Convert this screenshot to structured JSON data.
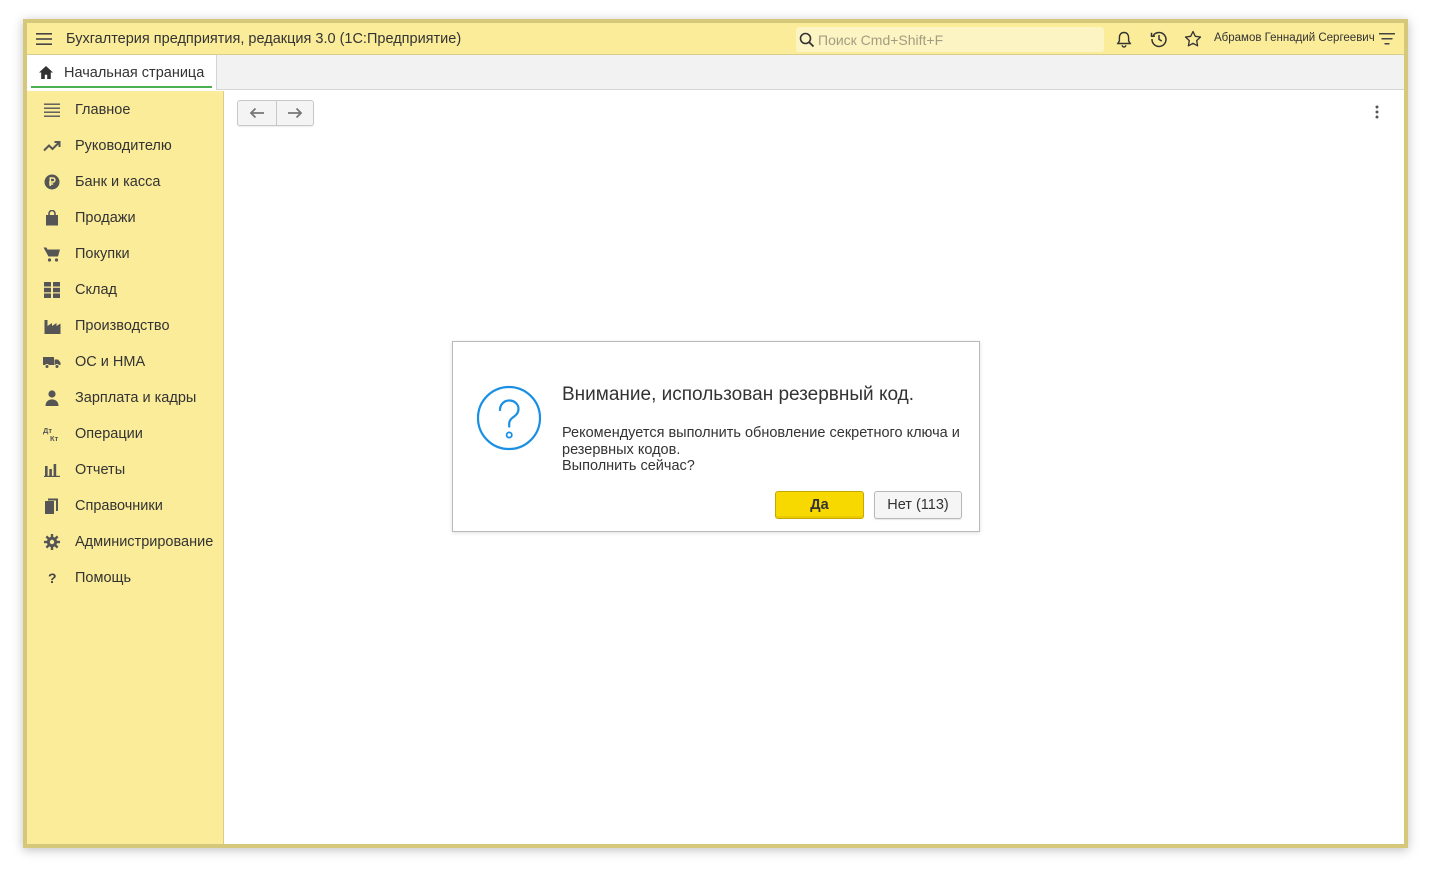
{
  "titlebar": {
    "app_title": "Бухгалтерия предприятия, редакция 3.0  (1С:Предприятие)",
    "search_placeholder": "Поиск Cmd+Shift+F",
    "user_name": "Абрамов Геннадий Сергеевич"
  },
  "tabs": [
    {
      "label": "Начальная страница",
      "icon": "home-icon"
    }
  ],
  "sidebar": {
    "items": [
      {
        "label": "Главное",
        "icon": "list-icon"
      },
      {
        "label": "Руководителю",
        "icon": "trend-up-icon"
      },
      {
        "label": "Банк и касса",
        "icon": "ruble-coin-icon"
      },
      {
        "label": "Продажи",
        "icon": "shopping-bag-icon"
      },
      {
        "label": "Покупки",
        "icon": "cart-icon"
      },
      {
        "label": "Склад",
        "icon": "warehouse-grid-icon"
      },
      {
        "label": "Производство",
        "icon": "factory-icon"
      },
      {
        "label": "ОС и НМА",
        "icon": "truck-icon"
      },
      {
        "label": "Зарплата и кадры",
        "icon": "person-icon"
      },
      {
        "label": "Операции",
        "icon": "dt-kt-icon"
      },
      {
        "label": "Отчеты",
        "icon": "bar-chart-icon"
      },
      {
        "label": "Справочники",
        "icon": "books-icon"
      },
      {
        "label": "Администрирование",
        "icon": "gear-icon"
      },
      {
        "label": "Помощь",
        "icon": "question-icon"
      }
    ]
  },
  "dialog": {
    "title": "Внимание, использован резервный код.",
    "message_line1": "Рекомендуется выполнить обновление секретного ключа и",
    "message_line2": "резервных кодов.",
    "message_line3": "Выполнить сейчас?",
    "yes_label": "Да",
    "no_label": "Нет (113)",
    "icon": "question-circle-icon"
  },
  "colors": {
    "panel_yellow": "#fbec9a",
    "primary_button": "#f7d900",
    "dialog_icon_blue": "#1a8fe3",
    "tab_underline_green": "#4caf50"
  }
}
